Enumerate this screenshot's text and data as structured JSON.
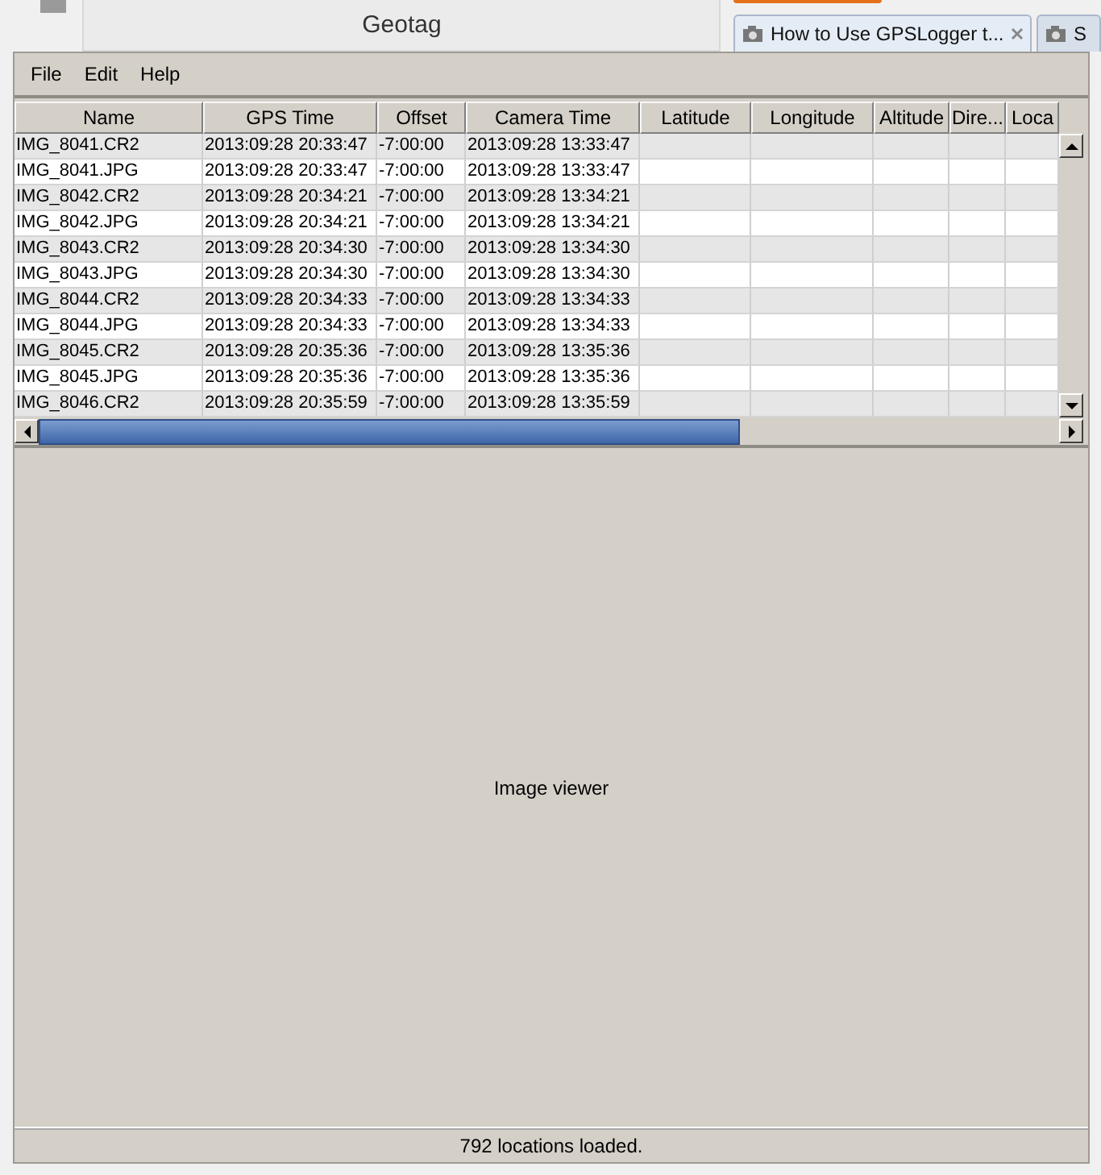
{
  "background": {
    "window_title": "Geotag",
    "browser_tabs": [
      {
        "label": "How to Use GPSLogger t...",
        "selected": true
      },
      {
        "label": "S",
        "selected": false
      }
    ]
  },
  "window": {
    "menu": [
      "File",
      "Edit",
      "Help"
    ],
    "table": {
      "columns": [
        "Name",
        "GPS Time",
        "Offset",
        "Camera Time",
        "Latitude",
        "Longitude",
        "Altitude",
        "Dire...",
        "Loca"
      ],
      "rows": [
        [
          "IMG_8041.CR2",
          "2013:09:28 20:33:47",
          "-7:00:00",
          "2013:09:28 13:33:47"
        ],
        [
          "IMG_8041.JPG",
          "2013:09:28 20:33:47",
          "-7:00:00",
          "2013:09:28 13:33:47"
        ],
        [
          "IMG_8042.CR2",
          "2013:09:28 20:34:21",
          "-7:00:00",
          "2013:09:28 13:34:21"
        ],
        [
          "IMG_8042.JPG",
          "2013:09:28 20:34:21",
          "-7:00:00",
          "2013:09:28 13:34:21"
        ],
        [
          "IMG_8043.CR2",
          "2013:09:28 20:34:30",
          "-7:00:00",
          "2013:09:28 13:34:30"
        ],
        [
          "IMG_8043.JPG",
          "2013:09:28 20:34:30",
          "-7:00:00",
          "2013:09:28 13:34:30"
        ],
        [
          "IMG_8044.CR2",
          "2013:09:28 20:34:33",
          "-7:00:00",
          "2013:09:28 13:34:33"
        ],
        [
          "IMG_8044.JPG",
          "2013:09:28 20:34:33",
          "-7:00:00",
          "2013:09:28 13:34:33"
        ],
        [
          "IMG_8045.CR2",
          "2013:09:28 20:35:36",
          "-7:00:00",
          "2013:09:28 13:35:36"
        ],
        [
          "IMG_8045.JPG",
          "2013:09:28 20:35:36",
          "-7:00:00",
          "2013:09:28 13:35:36"
        ],
        [
          "IMG_8046.CR2",
          "2013:09:28 20:35:59",
          "-7:00:00",
          "2013:09:28 13:35:59"
        ]
      ]
    },
    "image_viewer": "Image viewer",
    "status_bar": "792 locations loaded."
  }
}
